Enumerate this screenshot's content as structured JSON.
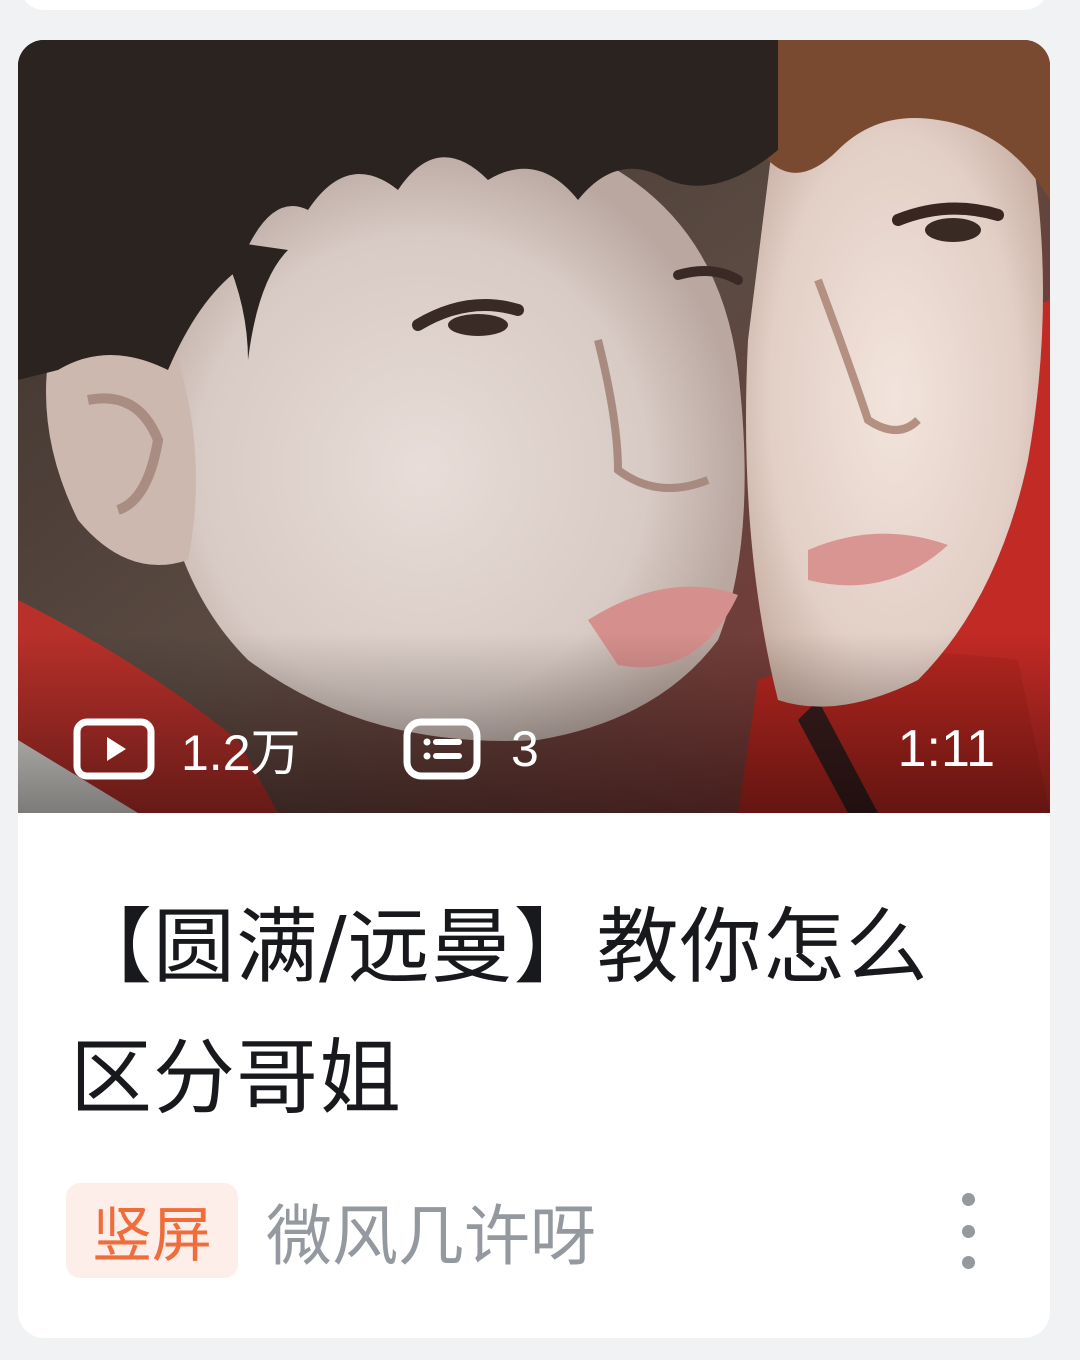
{
  "card": {
    "thumbnail": {
      "stats": {
        "views": "1.2万",
        "comments": "3"
      },
      "duration": "1:11"
    },
    "title": "【圆满/远曼】教你怎么区分哥姐",
    "badge": "竖屏",
    "author": "微风几许呀"
  },
  "icons": {
    "views": "play-icon",
    "comments": "danmaku-icon",
    "more": "more-vertical-icon"
  },
  "colors": {
    "badge_text": "#f06c3b",
    "badge_bg": "#fdeee9",
    "author_text": "#9499a0",
    "title_text": "#18191c"
  }
}
